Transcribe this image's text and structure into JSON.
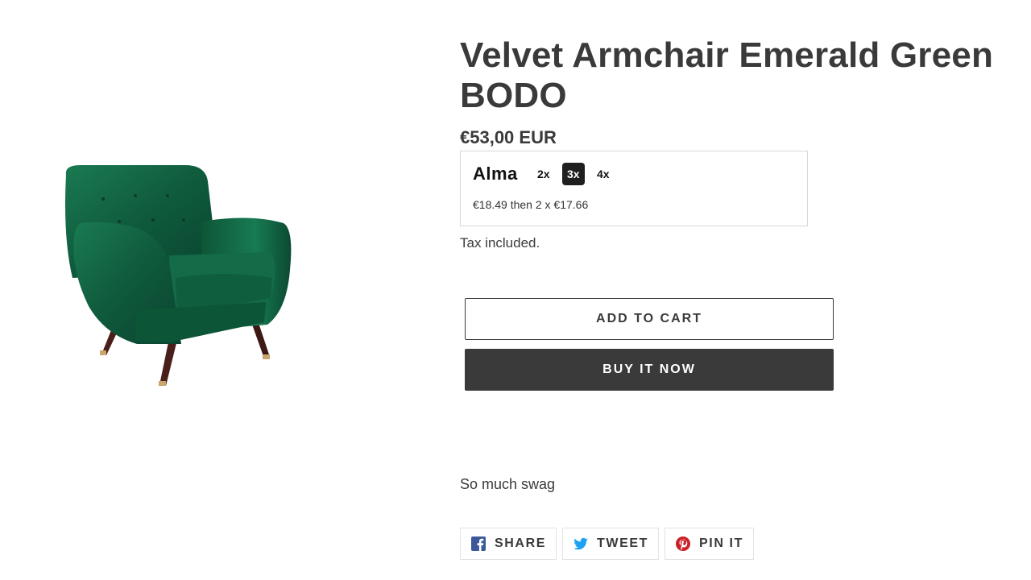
{
  "product": {
    "title": "Velvet Armchair Emerald Green BODO",
    "price": "€53,00 EUR",
    "tax_note": "Tax included.",
    "description": "So much swag"
  },
  "alma": {
    "logo": "Alma",
    "options": [
      {
        "label": "2x",
        "selected": false
      },
      {
        "label": "3x",
        "selected": true
      },
      {
        "label": "4x",
        "selected": false
      }
    ],
    "schedule": "€18.49 then 2 x €17.66"
  },
  "actions": {
    "add_to_cart": "ADD TO CART",
    "buy_now": "BUY IT NOW"
  },
  "social": [
    {
      "label": "SHARE",
      "icon": "facebook-icon",
      "color": "#3b5998"
    },
    {
      "label": "TWEET",
      "icon": "twitter-icon",
      "color": "#1da1f2"
    },
    {
      "label": "PIN IT",
      "icon": "pinterest-icon",
      "color": "#cb2027"
    }
  ],
  "colors": {
    "text": "#3a3a3a",
    "buy_button_bg": "#3a3a3a",
    "chair_velvet": "#0f5a3c"
  }
}
